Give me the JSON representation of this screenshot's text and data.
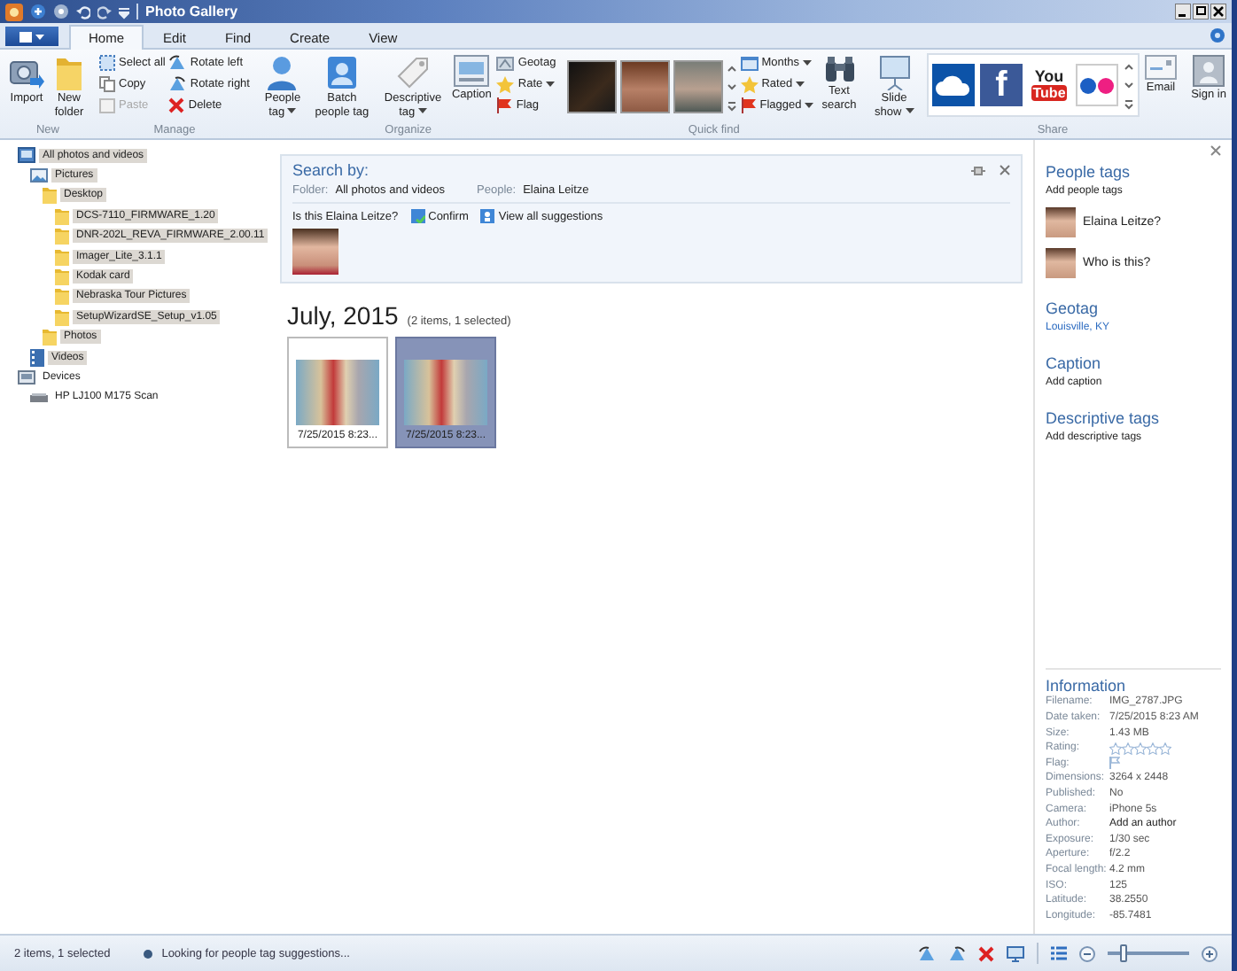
{
  "window": {
    "title": "Photo Gallery"
  },
  "tabs": [
    {
      "label": "Home",
      "selected": true
    },
    {
      "label": "Edit",
      "selected": false
    },
    {
      "label": "Find",
      "selected": false
    },
    {
      "label": "Create",
      "selected": false
    },
    {
      "label": "View",
      "selected": false
    }
  ],
  "ribbon": {
    "new": {
      "title": "New",
      "buttons": [
        "Import",
        "New folder"
      ]
    },
    "manage": {
      "title": "Manage",
      "buttons": [
        {
          "label": "Select all",
          "disabled": false
        },
        {
          "label": "Copy",
          "disabled": false
        },
        {
          "label": "Paste",
          "disabled": true
        },
        {
          "label": "Rotate left",
          "disabled": false
        },
        {
          "label": "Rotate right",
          "disabled": false
        },
        {
          "label": "Delete",
          "disabled": false
        }
      ]
    },
    "organize": {
      "title": "Organize",
      "buttons": [
        "People tag",
        "Batch people tag",
        "Descriptive tag",
        "Caption",
        "Geotag",
        "Rate",
        "Flag"
      ]
    },
    "quick_find": {
      "title": "Quick find",
      "buttons": [
        "Months",
        "Rated",
        "Flagged",
        "Text search"
      ]
    },
    "slide_show": {
      "label": "Slide show"
    },
    "share": {
      "title": "Share",
      "tiles": [
        {
          "kind": "cloud"
        },
        {
          "kind": "facebook",
          "text": "f"
        },
        {
          "kind": "youtube",
          "text": "You",
          "text_2": "Tube"
        },
        {
          "kind": "flickr"
        }
      ],
      "email": "Email"
    },
    "sign_in": {
      "label": "Sign in"
    }
  },
  "tree": [
    {
      "label": "All photos and videos",
      "kind": "library",
      "highlighted": true,
      "children": [
        {
          "label": "Pictures",
          "kind": "pictures",
          "highlighted": true,
          "children": [
            {
              "label": "Desktop",
              "kind": "folder",
              "highlighted": true,
              "children": [
                {
                  "label": "DCS-7110_FIRMWARE_1.20",
                  "kind": "folder",
                  "highlighted": true
                },
                {
                  "label": "DNR-202L_REVA_FIRMWARE_2.00.11",
                  "kind": "folder",
                  "highlighted": true
                },
                {
                  "label": "Imager_Lite_3.1.1",
                  "kind": "folder",
                  "highlighted": true
                },
                {
                  "label": "Kodak card",
                  "kind": "folder",
                  "highlighted": true
                },
                {
                  "label": "Nebraska Tour Pictures",
                  "kind": "folder",
                  "highlighted": true
                },
                {
                  "label": "SetupWizardSE_Setup_v1.05",
                  "kind": "folder",
                  "highlighted": true
                }
              ]
            },
            {
              "label": "Photos",
              "kind": "folder",
              "highlighted": true
            }
          ]
        },
        {
          "label": "Videos",
          "kind": "videos",
          "highlighted": true
        }
      ]
    },
    {
      "label": "Devices",
      "kind": "devices",
      "highlighted": false,
      "children": [
        {
          "label": "HP LJ100 M175 Scan",
          "kind": "scanner",
          "highlighted": false
        }
      ]
    }
  ],
  "search": {
    "title": "Search by:",
    "folder_label": "Folder:",
    "folder": "All photos and videos",
    "people_label": "People:",
    "people": "Elaina Leitze",
    "question": "Is this Elaina Leitze?",
    "confirm": "Confirm",
    "view_all": "View all suggestions"
  },
  "group": {
    "title": "July, 2015",
    "count": "(2 items, 1 selected)",
    "photos": [
      {
        "caption": "7/25/2015 8:23...",
        "selected": false
      },
      {
        "caption": "7/25/2015 8:23...",
        "selected": true
      }
    ]
  },
  "details": {
    "people_tags": {
      "title": "People tags",
      "add": "Add people tags",
      "people": [
        {
          "name": "Elaina Leitze?"
        },
        {
          "name": "Who is this?"
        }
      ]
    },
    "geotag": {
      "title": "Geotag",
      "value": "Louisville, KY"
    },
    "caption": {
      "title": "Caption",
      "add": "Add caption"
    },
    "descriptive_tags": {
      "title": "Descriptive tags",
      "add": "Add descriptive tags"
    }
  },
  "information": {
    "title": "Information",
    "rows": [
      {
        "label": "Filename:",
        "kind": "text",
        "value": "IMG_2787.JPG"
      },
      {
        "label": "Date taken:",
        "kind": "text",
        "value": "7/25/2015  8:23 AM"
      },
      {
        "label": "Size:",
        "kind": "text",
        "value": "1.43 MB"
      },
      {
        "label": "Rating:",
        "kind": "stars",
        "stars": 0
      },
      {
        "label": "Flag:",
        "kind": "flag",
        "flagged": false
      },
      {
        "label": "Dimensions:",
        "kind": "text",
        "value": "3264 x 2448"
      },
      {
        "label": "Published:",
        "kind": "text",
        "value": "No"
      },
      {
        "label": "Camera:",
        "kind": "text",
        "value": "iPhone 5s"
      },
      {
        "label": "Author:",
        "kind": "action",
        "value": "Add an author"
      },
      {
        "label": "Exposure:",
        "kind": "text",
        "value": "1/30 sec"
      },
      {
        "label": "Aperture:",
        "kind": "text",
        "value": "f/2.2"
      },
      {
        "label": "Focal length:",
        "kind": "text",
        "value": "4.2 mm"
      },
      {
        "label": "ISO:",
        "kind": "text",
        "value": "125"
      },
      {
        "label": "Latitude:",
        "kind": "text",
        "value": "38.2550"
      },
      {
        "label": "Longitude:",
        "kind": "text",
        "value": "-85.7481"
      }
    ]
  },
  "status": {
    "selection": "2 items, 1 selected",
    "message": "Looking for people tag suggestions..."
  },
  "zoom": {
    "level": 0.2
  }
}
